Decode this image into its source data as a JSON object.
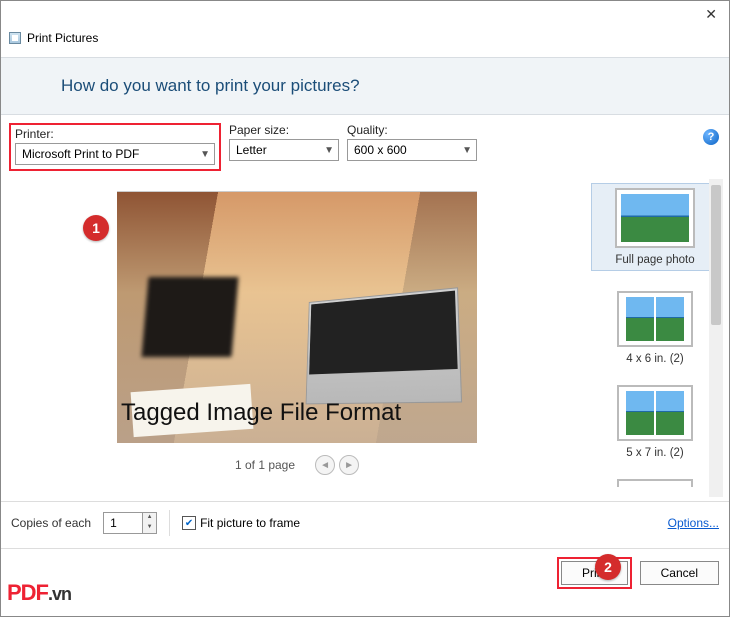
{
  "window": {
    "title": "Print Pictures"
  },
  "header": {
    "question": "How do you want to print your pictures?"
  },
  "printer": {
    "label": "Printer:",
    "value": "Microsoft Print to PDF"
  },
  "paper": {
    "label": "Paper size:",
    "value": "Letter"
  },
  "quality": {
    "label": "Quality:",
    "value": "600 x 600"
  },
  "preview": {
    "overlay_text": "Tagged Image File Format",
    "pager_text": "1 of 1 page"
  },
  "layouts": {
    "items": [
      {
        "label": "Full page photo"
      },
      {
        "label": "4 x 6 in. (2)"
      },
      {
        "label": "5 x 7 in. (2)"
      }
    ]
  },
  "bottom": {
    "copies_label": "Copies of each",
    "copies_value": "1",
    "fit_label": "Fit picture to frame",
    "options_link": "Options...",
    "print_btn": "Print",
    "cancel_btn": "Cancel"
  },
  "annotations": {
    "marker1": "1",
    "marker2": "2",
    "watermark_main": "PDF",
    "watermark_sub": ".vn"
  }
}
